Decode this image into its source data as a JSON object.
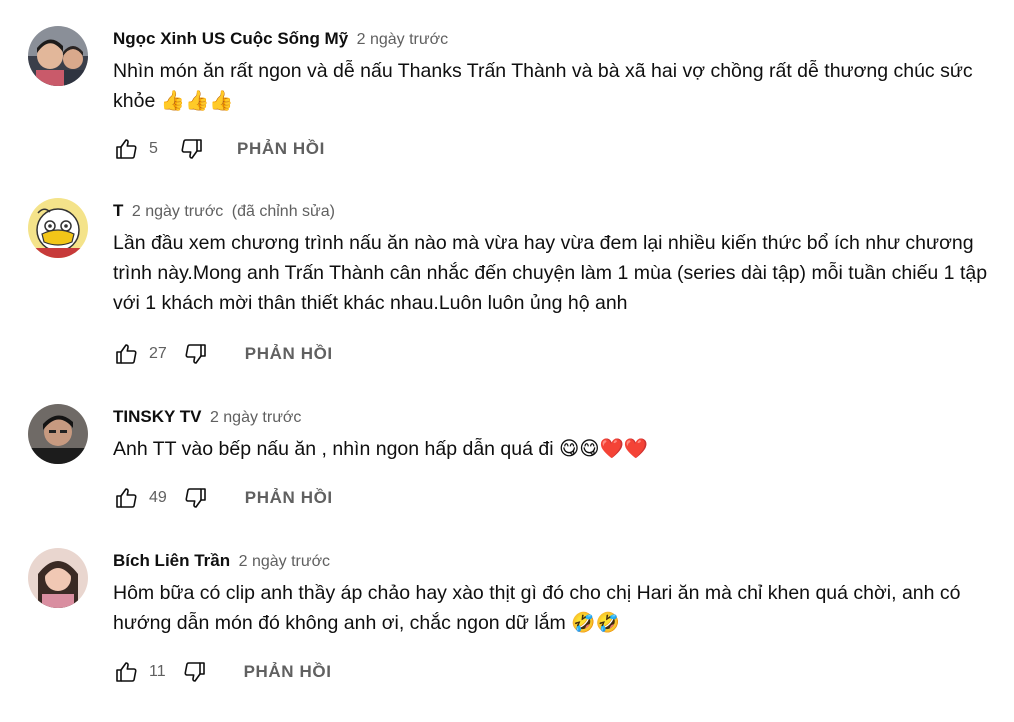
{
  "comments": [
    {
      "author": "Ngọc Xinh US Cuộc Sống Mỹ",
      "time": "2 ngày trước",
      "edited": "",
      "text": "Nhìn món ăn rất ngon và dễ nấu Thanks Trấn Thành và bà xã hai vợ chồng rất dễ thương chúc sức khỏe 👍👍👍",
      "likes": "5",
      "reply_label": "PHẢN HỒI"
    },
    {
      "author": "T",
      "time": "2 ngày trước",
      "edited": "(đã chỉnh sửa)",
      "text": "Lần đầu xem chương trình nấu ăn nào mà vừa hay vừa đem lại nhiều kiến thức bổ ích như chương trình này.Mong anh Trấn Thành cân nhắc đến chuyện làm 1 mùa (series dài tập) mỗi tuần chiếu 1 tập với 1 khách mời thân thiết khác nhau.Luôn luôn ủng hộ anh",
      "likes": "27",
      "reply_label": "PHẢN HỒI"
    },
    {
      "author": "TINSKY TV",
      "time": "2 ngày trước",
      "edited": "",
      "text": "Anh TT vào bếp nấu ăn , nhìn ngon hấp dẫn quá đi 😋😋❤️❤️",
      "likes": "49",
      "reply_label": "PHẢN HỒI"
    },
    {
      "author": "Bích Liên Trần",
      "time": "2 ngày trước",
      "edited": "",
      "text": "Hôm bữa có clip anh thầy áp chảo hay xào thịt gì đó cho chị Hari ăn mà chỉ khen quá chời, anh có hướng dẫn món đó không anh ơi, chắc ngon dữ lắm 🤣🤣",
      "likes": "11",
      "reply_label": "PHẢN HỒI"
    }
  ],
  "icons": {
    "like": "thumbs-up-icon",
    "dislike": "thumbs-down-icon"
  },
  "colors": {
    "text": "#0f0f0f",
    "secondary": "#606060",
    "background": "#ffffff"
  }
}
